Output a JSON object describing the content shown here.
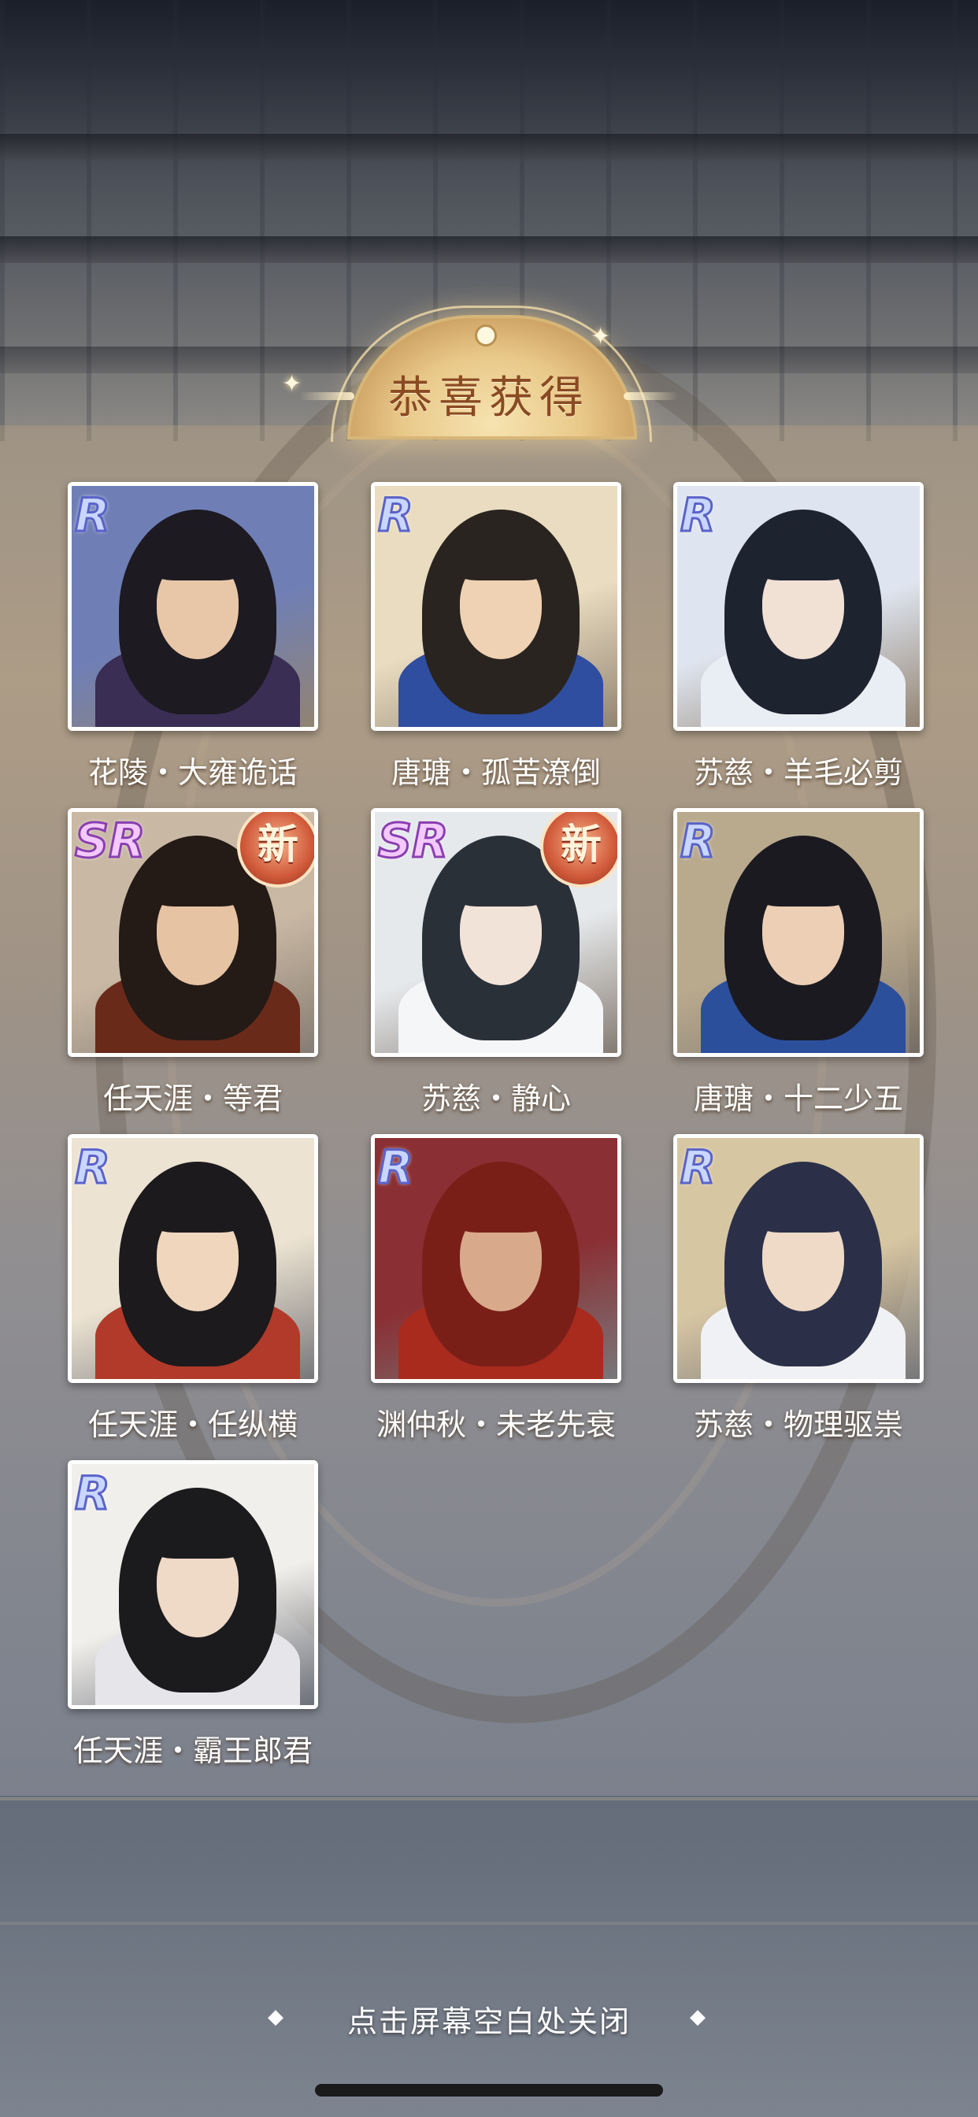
{
  "header": {
    "title": "恭喜获得"
  },
  "cards": [
    {
      "name": "花陵・大雍诡话",
      "rarity": "R",
      "is_new": false
    },
    {
      "name": "唐瑭・孤苦潦倒",
      "rarity": "R",
      "is_new": false
    },
    {
      "name": "苏慈・羊毛必剪",
      "rarity": "R",
      "is_new": false
    },
    {
      "name": "任天涯・等君",
      "rarity": "SR",
      "is_new": true
    },
    {
      "name": "苏慈・静心",
      "rarity": "SR",
      "is_new": true
    },
    {
      "name": "唐瑭・十二少五",
      "rarity": "R",
      "is_new": false
    },
    {
      "name": "任天涯・任纵横",
      "rarity": "R",
      "is_new": false
    },
    {
      "name": "渊仲秋・未老先衰",
      "rarity": "R",
      "is_new": false
    },
    {
      "name": "苏慈・物理驱祟",
      "rarity": "R",
      "is_new": false
    },
    {
      "name": "任天涯・霸王郎君",
      "rarity": "R",
      "is_new": false
    }
  ],
  "new_badge_label": "新",
  "footer": {
    "close_hint": "点击屏幕空白处关闭",
    "left_deco": "◆",
    "right_deco": "◆"
  }
}
